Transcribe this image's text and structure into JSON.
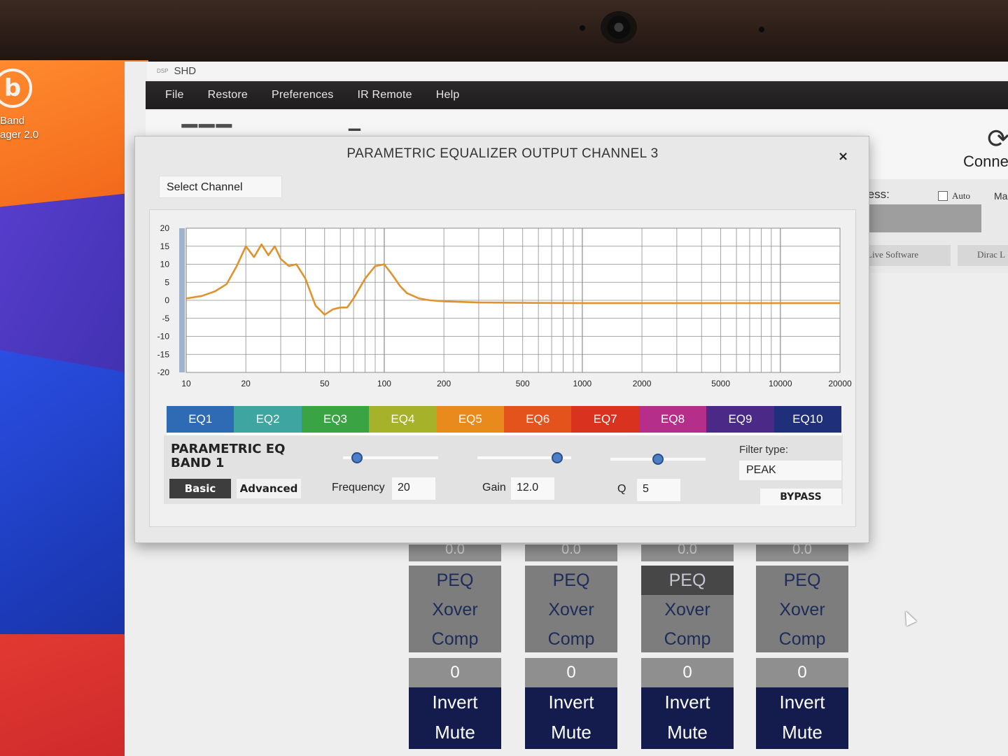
{
  "desktop": {
    "icon_glyph": "b",
    "label_line1": "Band",
    "label_line2": "ager 2.0"
  },
  "app": {
    "title": "SHD",
    "title_badge": "DSP",
    "menu": [
      "File",
      "Restore",
      "Preferences",
      "IR Remote",
      "Help"
    ],
    "connect_label": "Connect",
    "address_label": "ress:",
    "auto_label": "Auto",
    "ma_label": "Ma",
    "tab_live": "Live Software",
    "tab_dirac": "Dirac L"
  },
  "dialog": {
    "title": "PARAMETRIC EQUALIZER OUTPUT CHANNEL 3",
    "close_glyph": "×",
    "select_channel": "Select Channel",
    "band_title_line1": "PARAMETRIC EQ",
    "band_title_line2": "BAND 1",
    "basic_label": "Basic",
    "advanced_label": "Advanced",
    "frequency_label": "Frequency",
    "frequency_value": "20",
    "gain_label": "Gain",
    "gain_value": "12.0",
    "q_label": "Q",
    "q_value": "5",
    "filter_type_label": "Filter type:",
    "filter_type_value": "PEAK",
    "bypass_label": "BYPASS",
    "frequency_slider": 0.15,
    "gain_slider": 0.85,
    "q_slider": 0.5
  },
  "eq_tabs": [
    {
      "label": "EQ1",
      "color": "#2e6bb4"
    },
    {
      "label": "EQ2",
      "color": "#3fa5a0"
    },
    {
      "label": "EQ3",
      "color": "#3aa444"
    },
    {
      "label": "EQ4",
      "color": "#a5b22a"
    },
    {
      "label": "EQ5",
      "color": "#e98a1c"
    },
    {
      "label": "EQ6",
      "color": "#e5531d"
    },
    {
      "label": "EQ7",
      "color": "#d9321f"
    },
    {
      "label": "EQ8",
      "color": "#b52f8a"
    },
    {
      "label": "EQ9",
      "color": "#4a2a86"
    },
    {
      "label": "EQ10",
      "color": "#1f2f7a"
    }
  ],
  "chart_data": {
    "type": "line",
    "xscale": "log",
    "xlim": [
      10,
      20000
    ],
    "ylim": [
      -20,
      20
    ],
    "x_ticks": [
      10,
      20,
      50,
      100,
      200,
      500,
      1000,
      2000,
      5000,
      10000,
      20000
    ],
    "y_ticks": [
      20,
      15,
      10,
      5,
      0,
      -5,
      -10,
      -15,
      -20
    ],
    "grid": true,
    "line_color": "#e0922c",
    "series": [
      {
        "x": [
          10,
          12,
          14,
          16,
          18,
          20,
          22,
          24,
          26,
          28,
          30,
          33,
          36,
          40,
          45,
          50,
          55,
          60,
          65,
          70,
          80,
          90,
          100,
          110,
          120,
          130,
          150,
          170,
          200,
          300,
          500,
          1000,
          2000,
          5000,
          10000,
          20000
        ],
        "y": [
          0.5,
          1.2,
          2.5,
          4.5,
          9.5,
          15.0,
          12.0,
          15.5,
          12.5,
          15.0,
          11.5,
          9.5,
          10.0,
          6.0,
          -1.5,
          -4.0,
          -2.5,
          -2.0,
          -2.0,
          0.5,
          6.0,
          9.5,
          10.0,
          7.0,
          4.0,
          2.0,
          0.5,
          0.0,
          -0.3,
          -0.6,
          -0.7,
          -0.8,
          -0.8,
          -0.8,
          -0.8,
          -0.8
        ]
      }
    ]
  },
  "channel_strips": [
    {
      "top": "0.0",
      "peq": "PEQ",
      "xover": "Xover",
      "comp": "Comp",
      "zero": "0",
      "invert": "Invert",
      "mute": "Mute"
    },
    {
      "top": "0.0",
      "peq": "PEQ",
      "xover": "Xover",
      "comp": "Comp",
      "zero": "0",
      "invert": "Invert",
      "mute": "Mute"
    },
    {
      "top": "0.0",
      "peq": "PEQ",
      "xover": "Xover",
      "comp": "Comp",
      "zero": "0",
      "invert": "Invert",
      "mute": "Mute"
    },
    {
      "top": "0.0",
      "peq": "PEQ",
      "xover": "Xover",
      "comp": "Comp",
      "zero": "0",
      "invert": "Invert",
      "mute": "Mute"
    }
  ]
}
